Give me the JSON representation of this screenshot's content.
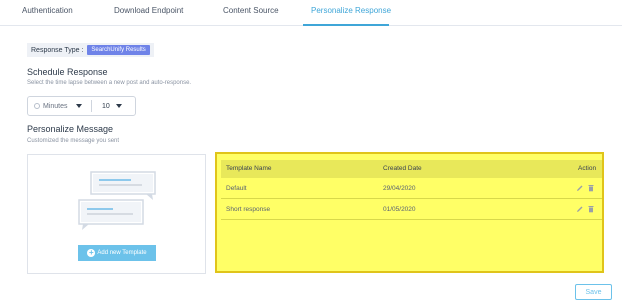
{
  "tabs": [
    {
      "label": "Authentication"
    },
    {
      "label": "Download Endpoint"
    },
    {
      "label": "Content Source"
    },
    {
      "label": "Personalize Response",
      "active": true
    }
  ],
  "response_type": {
    "label": "Response Type :",
    "value": "SearchUnify Results"
  },
  "schedule": {
    "title": "Schedule Response",
    "subtitle": "Select the time lapse between a new post and auto-response.",
    "unit_value": "Minutes",
    "amount_value": "10"
  },
  "personalize": {
    "title": "Personalize Message",
    "subtitle": "Customized the message you sent",
    "add_template_label": "Add new Template"
  },
  "table": {
    "headers": {
      "name": "Template Name",
      "date": "Created Date",
      "action": "Action"
    },
    "rows": [
      {
        "name": "Default",
        "date": "29/04/2020"
      },
      {
        "name": "Short response",
        "date": "01/05/2020"
      }
    ],
    "highlight_color": "#ffff66"
  },
  "save_label": "Save",
  "colors": {
    "accent": "#3fa6d8",
    "button": "#6cc2ea",
    "badge": "#6f83e8"
  }
}
